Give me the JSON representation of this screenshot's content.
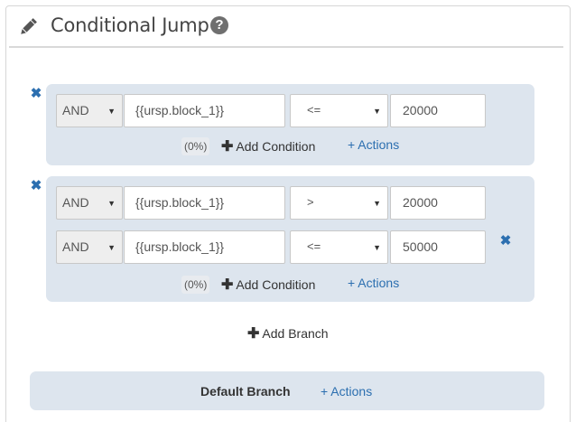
{
  "header": {
    "title": "Conditional Jump",
    "help_glyph": "?"
  },
  "branches": [
    {
      "conditions": [
        {
          "logic": "AND",
          "field": "{{ursp.block_1}}",
          "operator": "<=",
          "value": "20000"
        }
      ],
      "percent": "(0%)",
      "add_condition_label": "Add Condition",
      "actions_label": "+ Actions"
    },
    {
      "conditions": [
        {
          "logic": "AND",
          "field": "{{ursp.block_1}}",
          "operator": ">",
          "value": "20000"
        },
        {
          "logic": "AND",
          "field": "{{ursp.block_1}}",
          "operator": "<=",
          "value": "50000"
        }
      ],
      "percent": "(0%)",
      "add_condition_label": "Add Condition",
      "actions_label": "+ Actions"
    }
  ],
  "add_branch_label": "Add Branch",
  "default_branch": {
    "label": "Default Branch",
    "actions_label": "+ Actions"
  },
  "colors": {
    "accent": "#2c6fb0",
    "branch_bg": "#dde5ee"
  },
  "icons": {
    "edit": "pencil-icon",
    "help": "question-circle-icon",
    "remove": "close-icon",
    "add": "plus-icon"
  }
}
